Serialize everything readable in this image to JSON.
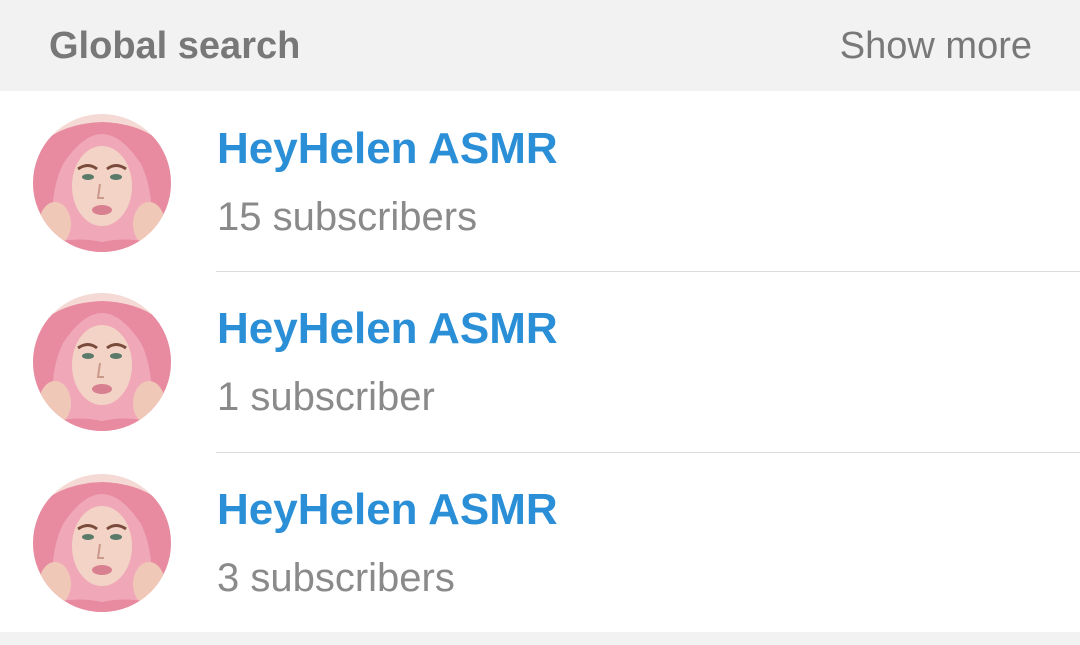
{
  "header": {
    "title": "Global search",
    "show_more_label": "Show more"
  },
  "results": [
    {
      "name": "HeyHelen ASMR",
      "subscribers": "15 subscribers",
      "avatar_icon": "channel-avatar-photo"
    },
    {
      "name": "HeyHelen ASMR",
      "subscribers": "1 subscriber",
      "avatar_icon": "channel-avatar-photo"
    },
    {
      "name": "HeyHelen ASMR",
      "subscribers": "3 subscribers",
      "avatar_icon": "channel-avatar-photo"
    }
  ],
  "colors": {
    "accent": "#2a8fd6",
    "secondary_text": "#8a8a8a",
    "header_bg": "#f2f2f2",
    "hair_pink": "#e88aa0"
  }
}
